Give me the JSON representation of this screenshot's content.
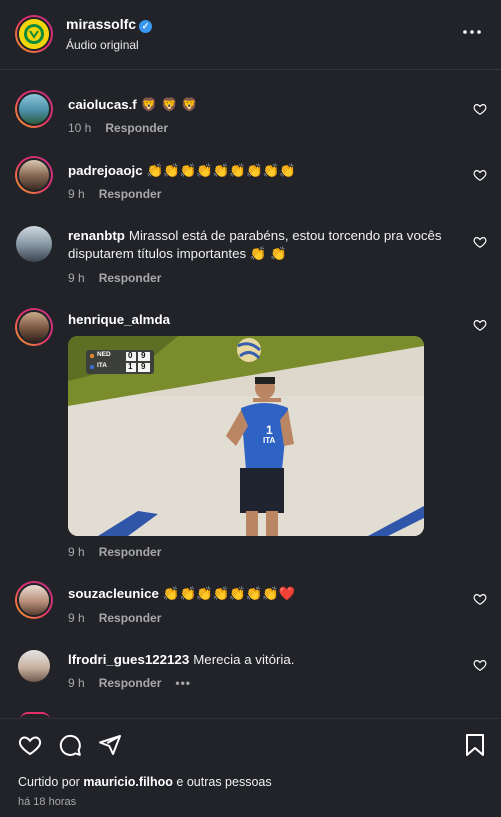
{
  "header": {
    "username": "mirassolfc",
    "verified_glyph": "✓",
    "subtitle": "Áudio original",
    "more_icon": "more-horizontal-icon"
  },
  "comments": [
    {
      "username": "caiolucas.f",
      "text": "🦁 🦁 🦁",
      "time": "10 h",
      "reply": "Responder"
    },
    {
      "username": "padrejoaojc",
      "text": "👏👏👏👏👏👏👏👏👏",
      "time": "9 h",
      "reply": "Responder"
    },
    {
      "username": "renanbtp",
      "text": "Mirassol está de parabéns, estou torcendo pra vocês disputarem títulos importantes 👏 👏",
      "time": "9 h",
      "reply": "Responder"
    },
    {
      "username": "henrique_almda",
      "text": "",
      "time": "9 h",
      "reply": "Responder"
    },
    {
      "username": "souzacleunice",
      "text": "👏👏👏👏👏👏👏❤️",
      "time": "9 h",
      "reply": "Responder"
    },
    {
      "username": "lfrodri_gues122123",
      "text": "Merecia a vitória.",
      "time": "9 h",
      "reply": "Responder",
      "more": "•••"
    }
  ],
  "gif": {
    "scoreboard": {
      "team1": "NED",
      "team1_sets": "0",
      "team1_points": "9",
      "team2": "ITA",
      "team2_sets": "1",
      "team2_points": "9"
    },
    "jersey_number": "1",
    "jersey_country": "ITA"
  },
  "footer": {
    "liked_prefix": "Curtido por",
    "liked_user": "mauricio.filhoo",
    "liked_suffix": "e outras pessoas",
    "time_ago": "há 18 horas"
  },
  "colors": {
    "background": "#212328",
    "accent_blue": "#3897f0",
    "ring_gradient": [
      "#f9a825",
      "#e1306c",
      "#c13584"
    ],
    "muted_text": "#a8a8a8"
  }
}
